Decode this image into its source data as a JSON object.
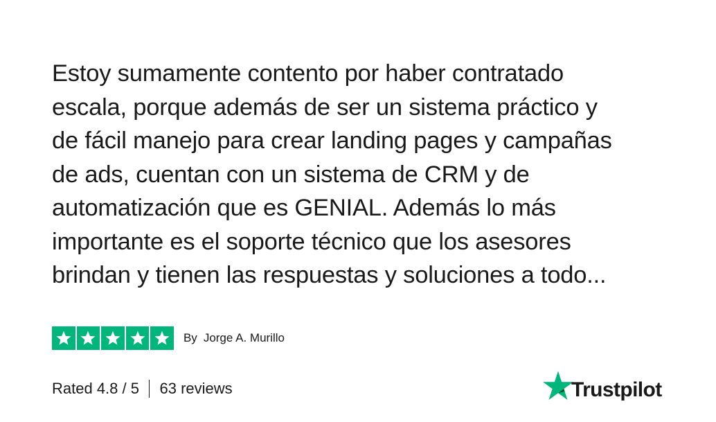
{
  "review": {
    "lines": [
      "Estoy sumamente contento por haber contratado",
      "escala, porque además de ser un sistema práctico y",
      "de fácil manejo para crear landing pages y campañas",
      "de ads, cuentan con un sistema de CRM y de",
      "automatización que es GENIAL. Además lo más",
      "importante es el soporte técnico que los asesores",
      "brindan y tienen las respuestas y soluciones a todo..."
    ],
    "stars": 5,
    "star_color": "#00b67a",
    "by_label": "By",
    "author": "Jorge A. Murillo"
  },
  "summary": {
    "rated_label": "Rated 4.8 / 5",
    "reviews_label": "63 reviews"
  },
  "brand": {
    "name": "Trustpilot",
    "icon": "trustpilot-star-icon",
    "color": "#00b67a"
  }
}
